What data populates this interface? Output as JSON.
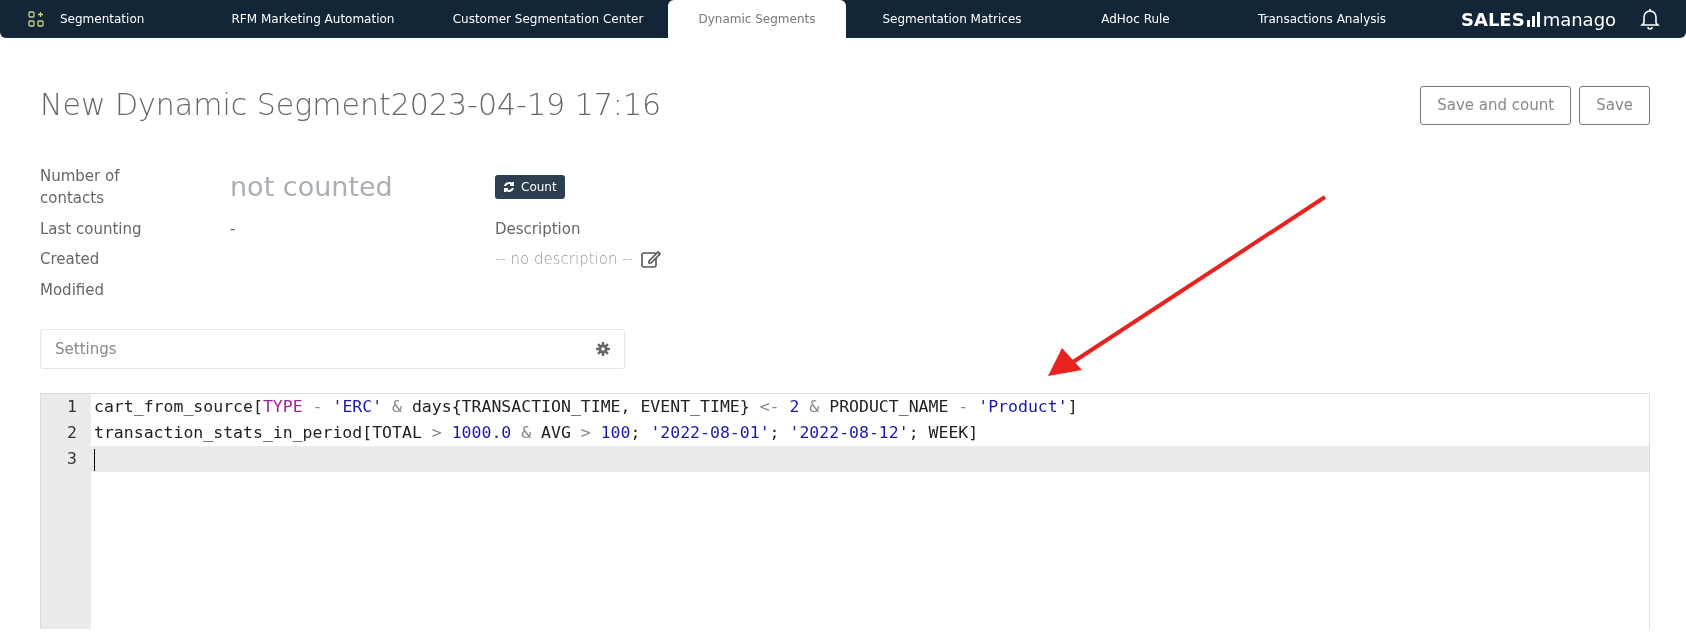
{
  "navbar": {
    "tabs": [
      {
        "label": "Segmentation",
        "selected": false
      },
      {
        "label": "RFM Marketing Automation",
        "selected": false
      },
      {
        "label": "Customer Segmentation Center",
        "selected": false
      },
      {
        "label": "Dynamic Segments",
        "selected": true
      },
      {
        "label": "Segmentation Matrices",
        "selected": false
      },
      {
        "label": "AdHoc Rule",
        "selected": false
      },
      {
        "label": "Transactions Analysis",
        "selected": false
      }
    ],
    "logo": {
      "left": "SALES",
      "right": "manago"
    }
  },
  "page": {
    "title": "New Dynamic Segment2023-04-19 17:16",
    "buttons": [
      "Save and count",
      "Save"
    ]
  },
  "info": {
    "contacts_label": "Number of contacts",
    "contacts_value": "not counted",
    "count_button": "Count",
    "rows": [
      {
        "label": "Last counting",
        "value": "-"
      },
      {
        "label": "Created"
      },
      {
        "label": "Modified"
      }
    ],
    "description_label": "Description",
    "description_value": "-- no description --"
  },
  "settings": {
    "label": "Settings"
  },
  "editor": {
    "lines": [
      {
        "number": "1",
        "active": false,
        "tokens": [
          {
            "kind": "plain",
            "text": "cart_from_source["
          },
          {
            "kind": "keyword",
            "text": "TYPE"
          },
          {
            "kind": "operator",
            "text": " - "
          },
          {
            "kind": "string",
            "text": "'ERC'"
          },
          {
            "kind": "operator",
            "text": " & "
          },
          {
            "kind": "plain",
            "text": "days{TRANSACTION_TIME, EVENT_TIME}"
          },
          {
            "kind": "operator",
            "text": " <- "
          },
          {
            "kind": "number",
            "text": "2"
          },
          {
            "kind": "operator",
            "text": " & "
          },
          {
            "kind": "plain",
            "text": "PRODUCT_NAME"
          },
          {
            "kind": "operator",
            "text": " - "
          },
          {
            "kind": "string",
            "text": "'Product'"
          },
          {
            "kind": "plain",
            "text": "]"
          }
        ]
      },
      {
        "number": "2",
        "active": false,
        "tokens": [
          {
            "kind": "plain",
            "text": "transaction_stats_in_period[TOTAL"
          },
          {
            "kind": "operator",
            "text": " > "
          },
          {
            "kind": "number",
            "text": "1000.0"
          },
          {
            "kind": "operator",
            "text": " & "
          },
          {
            "kind": "plain",
            "text": "AVG"
          },
          {
            "kind": "operator",
            "text": " > "
          },
          {
            "kind": "number",
            "text": "100"
          },
          {
            "kind": "plain",
            "text": "; "
          },
          {
            "kind": "string",
            "text": "'2022-08-01'"
          },
          {
            "kind": "plain",
            "text": "; "
          },
          {
            "kind": "string",
            "text": "'2022-08-12'"
          },
          {
            "kind": "plain",
            "text": "; WEEK]"
          }
        ]
      },
      {
        "number": "3",
        "active": true
      }
    ]
  }
}
